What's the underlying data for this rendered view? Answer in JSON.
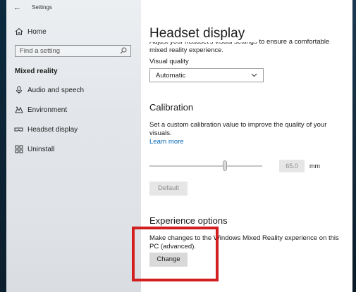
{
  "app": {
    "title": "Settings",
    "back_glyph": "←"
  },
  "sidebar": {
    "home_label": "Home",
    "search": {
      "placeholder": "Find a setting"
    },
    "section_title": "Mixed reality",
    "items": [
      {
        "label": "Audio and speech",
        "icon": "microphone-icon",
        "glyph": "🎙"
      },
      {
        "label": "Environment",
        "icon": "environment-icon",
        "glyph": "⚙"
      },
      {
        "label": "Headset display",
        "icon": "headset-icon",
        "glyph": "▭"
      },
      {
        "label": "Uninstall",
        "icon": "uninstall-icon",
        "glyph": "⊞"
      }
    ]
  },
  "main": {
    "title": "Headset display",
    "intro_text": "Adjust your headset's visual settings to ensure a comfortable mixed reality experience.",
    "visual_quality": {
      "label": "Visual quality",
      "value": "Automatic"
    },
    "calibration": {
      "title": "Calibration",
      "description": "Set a custom calibration value to improve the quality of your visuals.",
      "learn_more": "Learn more",
      "value": "65.0",
      "unit": "mm",
      "default_button": "Default"
    },
    "experience": {
      "title": "Experience options",
      "description": "Make changes to the Windows Mixed Reality experience on this PC (advanced).",
      "change_button": "Change"
    }
  },
  "colors": {
    "accent_link": "#0063b1",
    "highlight": "#d21e1e"
  }
}
